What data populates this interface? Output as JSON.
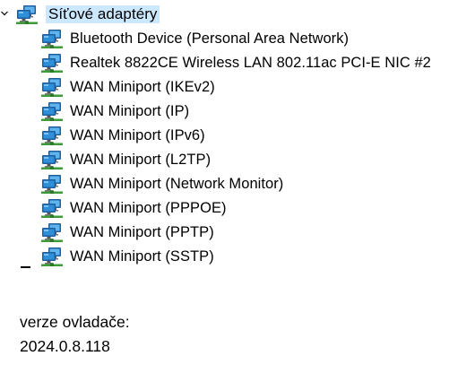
{
  "tree": {
    "category": {
      "label": "Síťové adaptéry",
      "icon": "network-adapter-icon",
      "expanded": true,
      "selected": true
    },
    "items": [
      {
        "label": "Bluetooth Device (Personal Area Network)",
        "icon": "network-adapter-icon"
      },
      {
        "label": "Realtek 8822CE Wireless LAN 802.11ac PCI-E NIC #2",
        "icon": "network-adapter-icon"
      },
      {
        "label": "WAN Miniport (IKEv2)",
        "icon": "network-adapter-icon"
      },
      {
        "label": "WAN Miniport (IP)",
        "icon": "network-adapter-icon"
      },
      {
        "label": "WAN Miniport (IPv6)",
        "icon": "network-adapter-icon"
      },
      {
        "label": "WAN Miniport (L2TP)",
        "icon": "network-adapter-icon"
      },
      {
        "label": "WAN Miniport (Network Monitor)",
        "icon": "network-adapter-icon"
      },
      {
        "label": "WAN Miniport (PPPOE)",
        "icon": "network-adapter-icon"
      },
      {
        "label": "WAN Miniport (PPTP)",
        "icon": "network-adapter-icon"
      },
      {
        "label": "WAN Miniport (SSTP)",
        "icon": "network-adapter-icon"
      }
    ]
  },
  "driver": {
    "label": "verze ovladače:",
    "value": "2024.0.8.118"
  },
  "colors": {
    "selection": "#cce8ff",
    "monitor_blue": "#2f8fd8",
    "monitor_frame": "#1f5fa0",
    "cable_green": "#3e9b3a"
  }
}
